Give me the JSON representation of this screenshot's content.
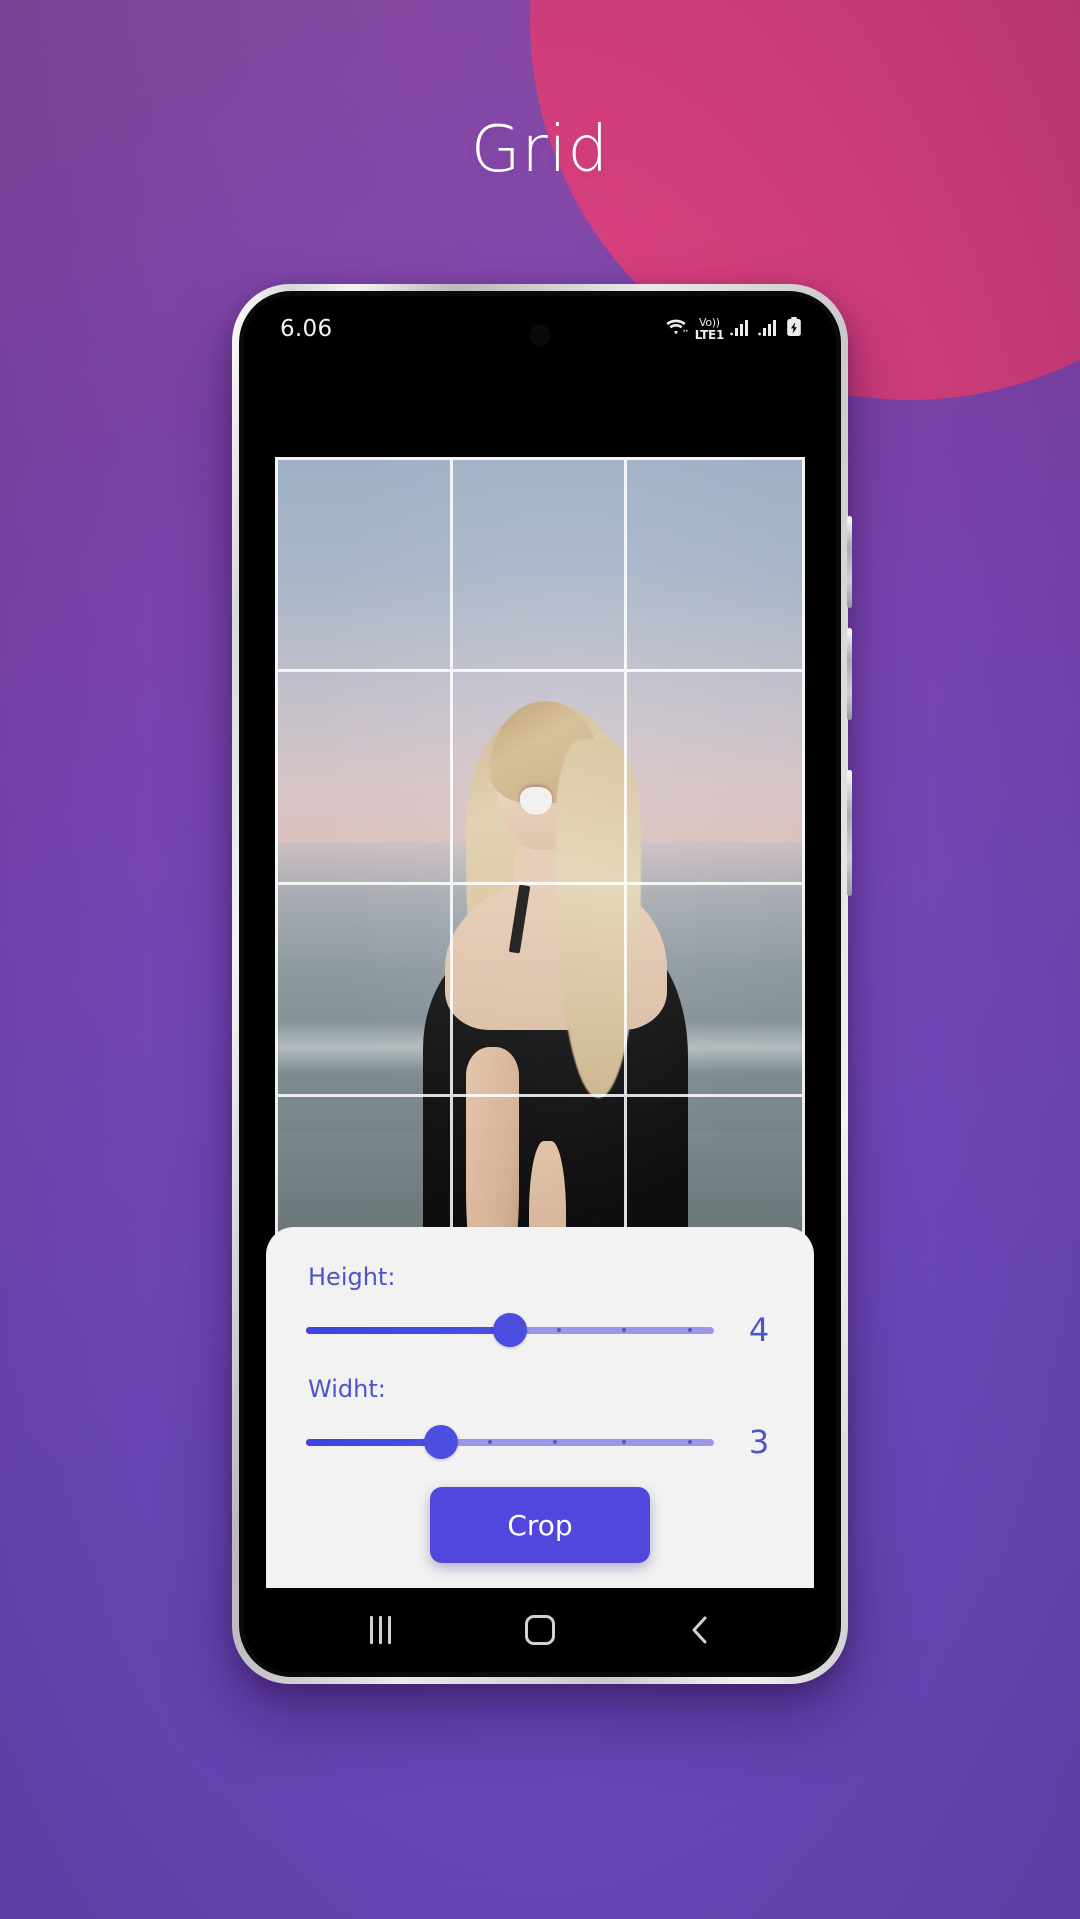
{
  "page": {
    "title": "Grid",
    "background_gradient_from": "#8d4fa8",
    "background_gradient_to": "#6a4cc0",
    "blob_color": "#d8407e"
  },
  "phone": {
    "frame_color": "#d9d9dd",
    "screen_background": "#000000",
    "side_buttons": [
      "volume-up",
      "volume-down",
      "power"
    ]
  },
  "statusbar": {
    "time": "6.06",
    "volte_top": "Vo))",
    "volte_bottom": "LTE1",
    "icons": [
      "wifi-icon",
      "volte-icon",
      "signal-bars-icon",
      "signal-bars-icon",
      "battery-charging-icon"
    ]
  },
  "photo": {
    "alt": "woman-on-beach-photo",
    "grid_rows": 4,
    "grid_cols": 3,
    "grid_line_color": "#ffffff"
  },
  "controls": {
    "accent_color": "#4e56c6",
    "height": {
      "label": "Height:",
      "value": "4",
      "percent": 50,
      "ticks": [
        62,
        78,
        94
      ]
    },
    "width": {
      "label": "Widht:",
      "value": "3",
      "percent": 33,
      "ticks": [
        45,
        61,
        78,
        94
      ]
    },
    "crop_button": {
      "label": "Crop",
      "color": "#5247dd",
      "text_color": "#ffffff"
    }
  },
  "navbar": {
    "recents_label": "Recents",
    "home_label": "Home",
    "back_label": "Back",
    "icons": [
      "recents-icon",
      "home-icon",
      "back-icon"
    ]
  }
}
